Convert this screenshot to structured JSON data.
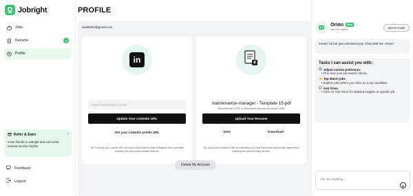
{
  "app": {
    "name": "Jobright"
  },
  "sidebar": {
    "items": [
      {
        "label": "Jobs",
        "icon": "briefcase-icon"
      },
      {
        "label": "Resume",
        "icon": "document-icon",
        "completed": true
      },
      {
        "label": "Profile",
        "icon": "user-icon",
        "active": true
      }
    ],
    "refer": {
      "title": "Refer & Earn",
      "desc": "Invite friends to Jobright and earn extra resume service credits!"
    },
    "feedback_label": "Feedback",
    "logout_label": "Logout"
  },
  "main": {
    "title": "PROFILE",
    "email": "aiwiki001@gmail.com",
    "linkedin": {
      "placeholder": "https://www.linkedin.com/in/",
      "update_button": "Update Your Linkedin URL",
      "get_link": "Get your Linkedin profile URL",
      "tip": "Tip: Providing your LinkedIn URL can help us find expired or past colleagues from your target company who can provide valuable referrals."
    },
    "resume": {
      "file_name": "maintenance-manager - Template 15.pdf",
      "note": "Files should be in PDF or Word format and must not exceed 10MB.",
      "upload_button": "Upload Your Resume",
      "view_label": "View",
      "download_label": "Download",
      "tip": "Tip: Upload your resume to help us understand your past experiences and provide improved job matching and resume writing services."
    },
    "delete_button": "Delete My Account"
  },
  "chat": {
    "name": "Orion",
    "badge": "Beta",
    "subtitle": "Your AI Copilot",
    "quick_guide": "Quick Guide",
    "greeting": "Great! You've just unlocked your Chat with me, Orion!",
    "tasks_title": "Tasks I can assist you with:",
    "tasks": [
      {
        "title": "Adjust current preference",
        "desc": "Fine-tune your job search criteria.",
        "icon": "search-icon"
      },
      {
        "title": "Top Match jobs",
        "desc": "Explore jobs where you shine as a top candidate.",
        "icon": "star-icon"
      },
      {
        "title": "Ask Orion",
        "desc": "Click on 'Ask Orion' for detailed insights on specific job.",
        "icon": "chat-icon"
      }
    ],
    "input_placeholder": "Ask me anything..."
  },
  "colors": {
    "brand": "#3ec16e",
    "panel": "#f2f3f5",
    "button": "#111111"
  }
}
